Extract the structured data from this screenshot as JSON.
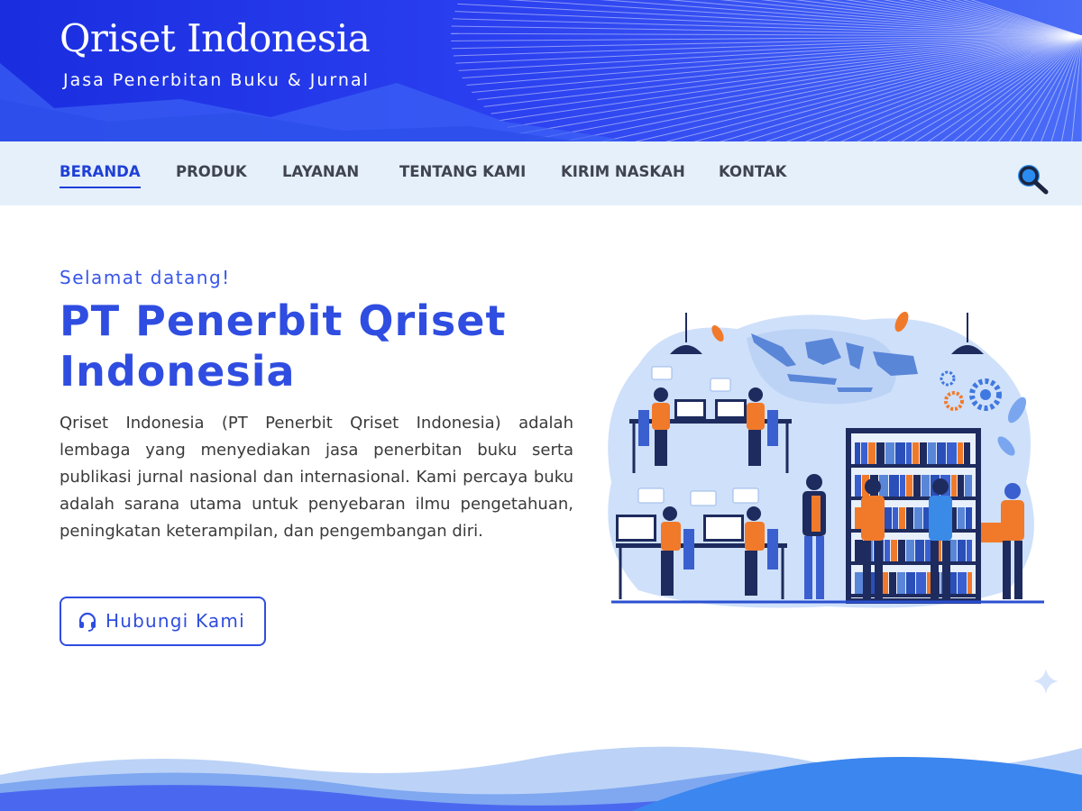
{
  "header": {
    "site_title": "Qriset Indonesia",
    "tagline": "Jasa Penerbitan Buku & Jurnal"
  },
  "nav": {
    "items": [
      {
        "label": "BERANDA",
        "active": true
      },
      {
        "label": "PRODUK",
        "active": false
      },
      {
        "label": "LAYANAN",
        "active": false
      },
      {
        "label": "TENTANG KAMI",
        "active": false
      },
      {
        "label": "KIRIM NASKAH",
        "active": false
      },
      {
        "label": "KONTAK",
        "active": false
      }
    ],
    "search_icon": "search-icon"
  },
  "hero": {
    "welcome": "Selamat datang!",
    "title": "PT Penerbit Qriset Indonesia",
    "description": "Qriset Indonesia (PT Penerbit Qriset Indonesia) adalah lembaga yang menyediakan jasa penerbitan buku serta publikasi jurnal nasional dan internasional. Kami percaya buku adalah sarana utama untuk penyebaran ilmu pengetahuan, peningkatan keterampilan, dan pengembangan diri.",
    "cta_label": "Hubungi Kami",
    "cta_icon": "headset-icon"
  },
  "colors": {
    "primary": "#2f4de0",
    "header_blue": "#1a2ee0",
    "nav_bg": "#e5f0fb",
    "accent_orange": "#f07a2a"
  }
}
